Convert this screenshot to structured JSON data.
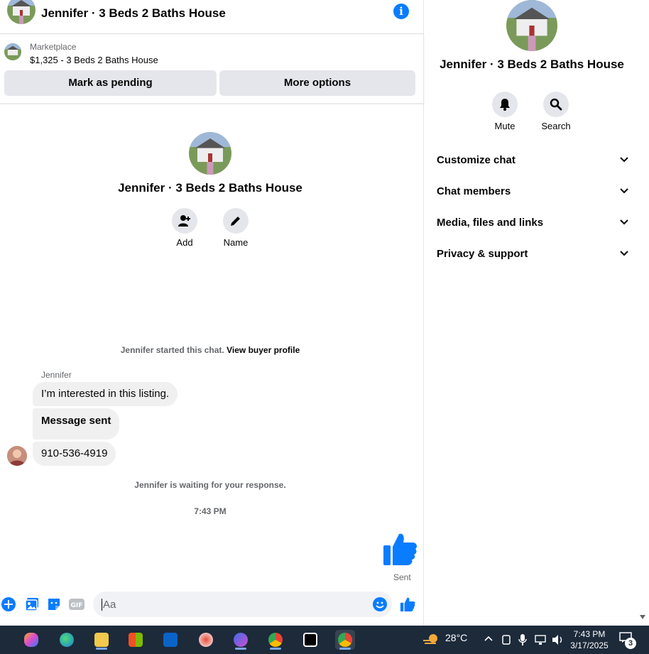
{
  "header": {
    "title": "Jennifer · 3 Beds 2 Baths House",
    "info_icon": "info-icon"
  },
  "marketplace": {
    "label": "Marketplace",
    "listing": "$1,325 - 3 Beds 2 Baths House",
    "mark_pending": "Mark as pending",
    "more_options": "More options"
  },
  "thread": {
    "title": "Jennifer · 3 Beds 2 Baths House",
    "actions": [
      {
        "label": "Add",
        "icon": "add-person-icon"
      },
      {
        "label": "Name",
        "icon": "pencil-icon"
      }
    ],
    "started_text": "Jennifer started this chat.",
    "view_profile": "View buyer profile",
    "sender": "Jennifer",
    "messages": [
      "I’m interested in this listing.",
      "Message sent",
      "910-536-4919"
    ],
    "waiting": "Jennifer is waiting for your response.",
    "time": "7:43 PM",
    "sent_label": "Sent"
  },
  "composer": {
    "placeholder": "Aa"
  },
  "sidebar": {
    "title": "Jennifer · 3 Beds 2 Baths House",
    "mute": "Mute",
    "search": "Search",
    "sections": [
      "Customize chat",
      "Chat members",
      "Media, files and links",
      "Privacy & support"
    ]
  },
  "taskbar": {
    "temperature": "28°C",
    "time": "7:43 PM",
    "date": "3/17/2025",
    "notifications": "3"
  },
  "colors": {
    "accent": "#0a7cff",
    "bubble": "#f0f0f0",
    "button": "#e4e6eb",
    "taskbar": "#1c2a3a"
  }
}
